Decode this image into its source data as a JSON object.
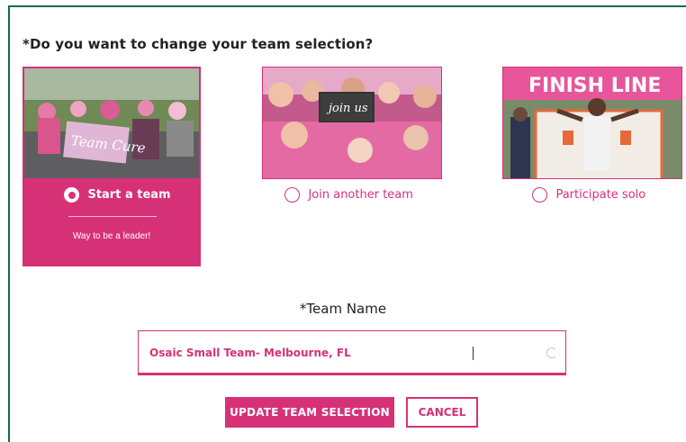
{
  "question": "*Do you want to change your team selection?",
  "options": [
    {
      "label": "Start a team",
      "selected": true,
      "subtitle": "Way to be a leader!"
    },
    {
      "label": "Join another team",
      "selected": false
    },
    {
      "label": "Participate solo",
      "selected": false
    }
  ],
  "photos": {
    "start_team_sign": "Team Cure",
    "join_sign": "join us",
    "solo_banner": "FINISH LINE"
  },
  "team_name": {
    "label": "*Team Name",
    "value": "Osaic Small Team- Melbourne, FL"
  },
  "buttons": {
    "update": "UPDATE TEAM SELECTION",
    "cancel": "CANCEL"
  },
  "colors": {
    "accent": "#d63177",
    "frame": "#0e6b58"
  }
}
